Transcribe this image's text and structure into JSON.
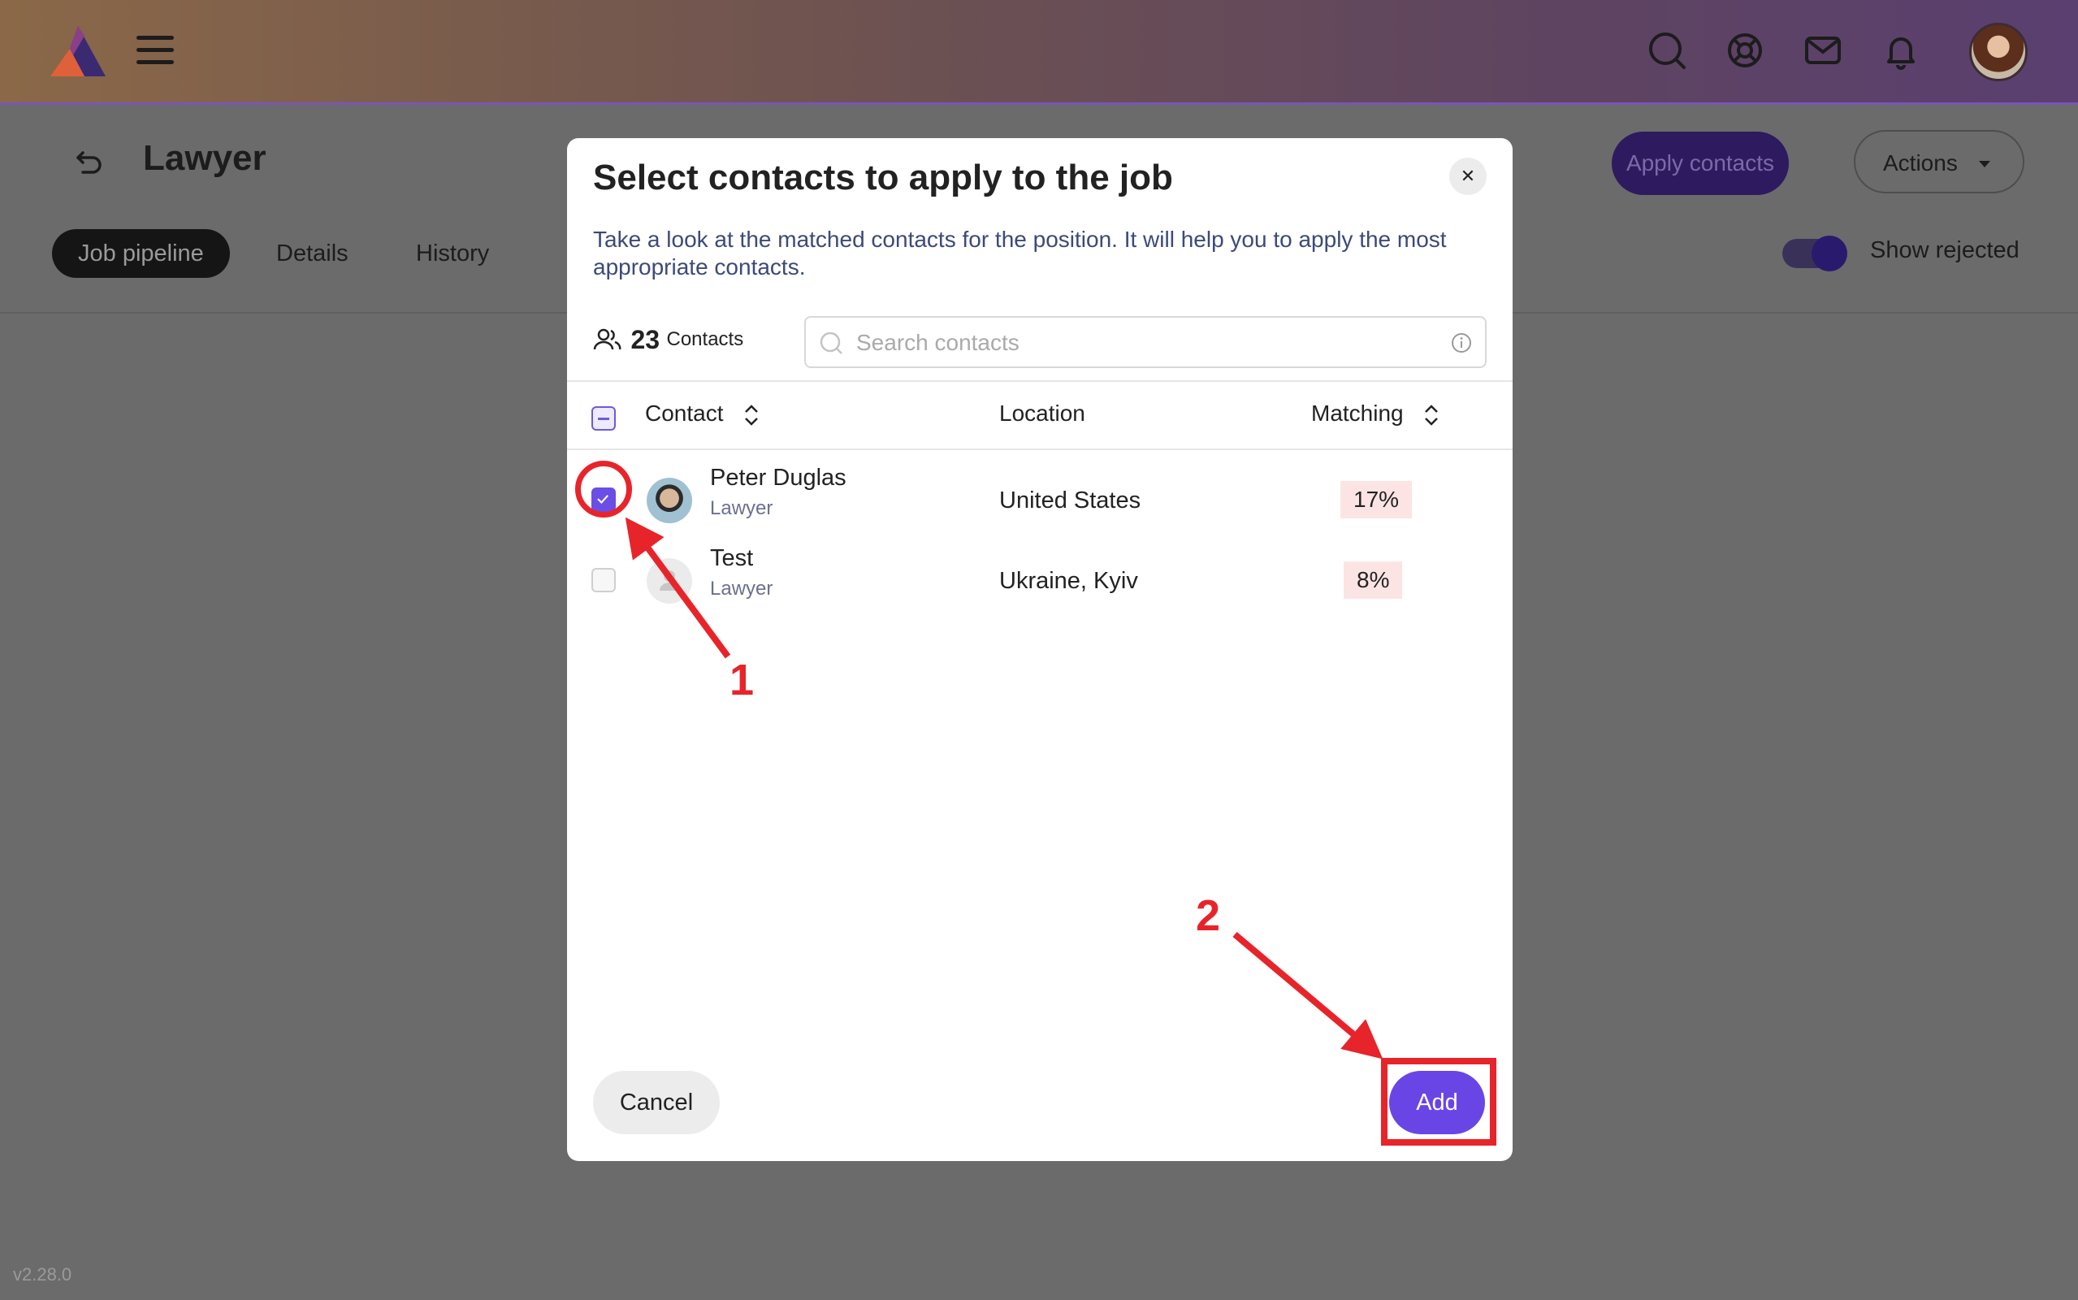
{
  "app": {
    "version": "v2.28.0",
    "header_icons": [
      "search-icon",
      "lifebuoy-icon",
      "mail-icon",
      "bell-icon"
    ]
  },
  "page": {
    "title": "Lawyer",
    "tabs": [
      {
        "label": "Job pipeline",
        "active": true
      },
      {
        "label": "Details",
        "active": false
      },
      {
        "label": "History",
        "active": false
      }
    ],
    "apply_contacts_label": "Apply contacts",
    "actions_label": "Actions",
    "show_rejected_label": "Show rejected",
    "show_rejected_on": true
  },
  "modal": {
    "title": "Select contacts to apply to the job",
    "description": "Take a look at the matched contacts for the position. It will help you to apply the most appropriate contacts.",
    "contacts_count": "23",
    "contacts_label": "Contacts",
    "search_placeholder": "Search contacts",
    "columns": {
      "contact": "Contact",
      "location": "Location",
      "matching": "Matching"
    },
    "rows": [
      {
        "name": "Peter Duglas",
        "role": "Lawyer",
        "location": "United States",
        "matching": "17%",
        "checked": true
      },
      {
        "name": "Test",
        "role": "Lawyer",
        "location": "Ukraine, Kyiv",
        "matching": "8%",
        "checked": false
      }
    ],
    "cancel_label": "Cancel",
    "add_label": "Add"
  },
  "annotations": {
    "step1": "1",
    "step2": "2",
    "color": "#e8242b"
  },
  "colors": {
    "accent": "#6a45e6",
    "match_badge_bg": "#fde4e4"
  }
}
